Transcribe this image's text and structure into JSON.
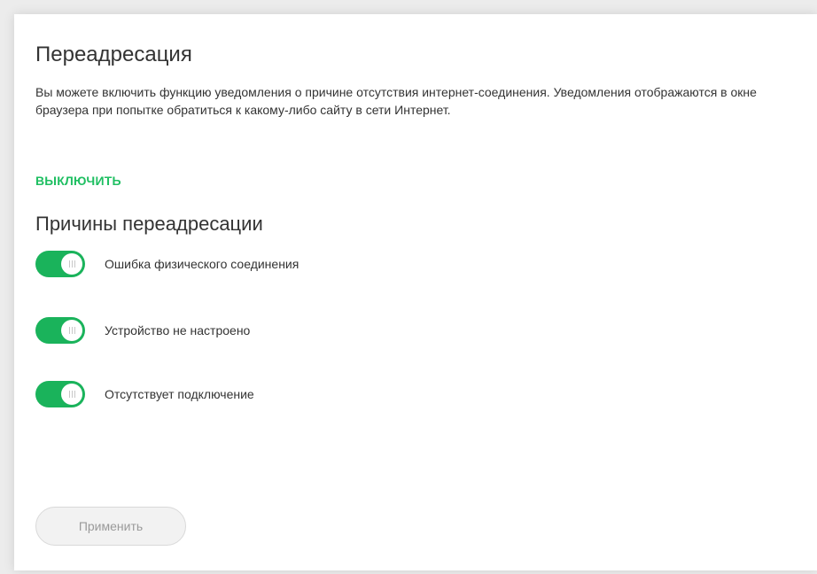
{
  "page": {
    "title": "Переадресация",
    "description": "Вы можете включить функцию уведомления о причине отсутствия интернет-соединения. Уведомления отображаются в окне браузера при попытке обратиться к какому-либо сайту в сети Интернет.",
    "toggle_link_label": "ВЫКЛЮЧИТЬ"
  },
  "reasons": {
    "title": "Причины переадресации",
    "items": [
      {
        "label": "Ошибка физического соединения",
        "enabled": true
      },
      {
        "label": "Устройство не настроено",
        "enabled": true
      },
      {
        "label": "Отсутствует подключение",
        "enabled": true
      }
    ]
  },
  "footer": {
    "apply_label": "Применить",
    "apply_disabled": true
  },
  "colors": {
    "accent": "#1ab35b",
    "link": "#1fbf62",
    "text": "#333333",
    "button_disabled_bg": "#f2f2f2",
    "button_disabled_text": "#9a9a9a"
  }
}
